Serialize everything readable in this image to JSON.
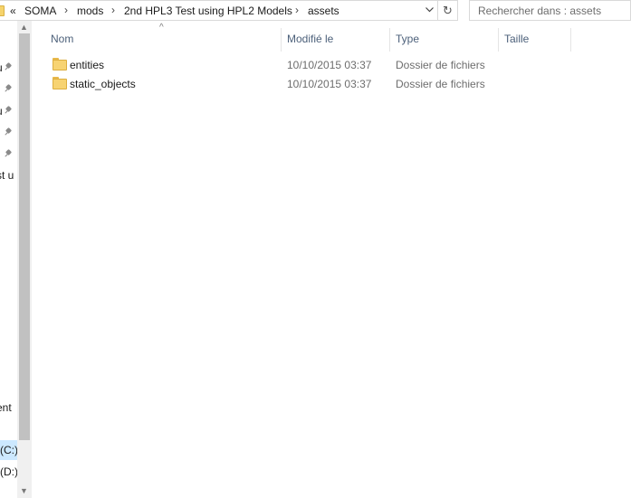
{
  "address_bar": {
    "overflow_chevron": "«",
    "separator": "›",
    "breadcrumbs": [
      "SOMA",
      "mods",
      "2nd HPL3 Test using HPL2 Models",
      "assets"
    ],
    "dropdown_icon": "chevron-down-icon",
    "refresh_glyph": "↻"
  },
  "search": {
    "placeholder": "Rechercher dans : assets"
  },
  "nav_pane": {
    "partial_labels": [
      "u",
      "u",
      "st u",
      "ent",
      "(C:)",
      "(D:)"
    ]
  },
  "columns": {
    "name": "Nom",
    "modified": "Modifié le",
    "type": "Type",
    "size": "Taille",
    "sort_indicator": "^"
  },
  "files": [
    {
      "name": "entities",
      "modified": "10/10/2015 03:37",
      "type": "Dossier de fichiers",
      "size": ""
    },
    {
      "name": "static_objects",
      "modified": "10/10/2015 03:37",
      "type": "Dossier de fichiers",
      "size": ""
    }
  ],
  "colors": {
    "selection": "#cce8ff",
    "header_text": "#4c607a",
    "folder_fill": "#f7d372"
  }
}
